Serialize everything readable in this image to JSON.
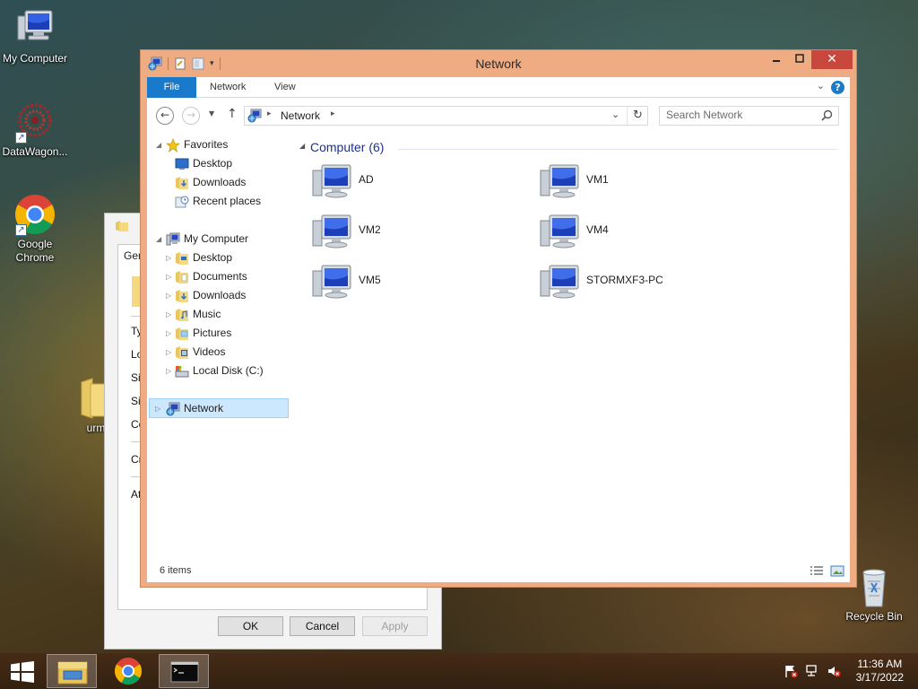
{
  "desktop": {
    "icons": [
      {
        "label": "My Computer"
      },
      {
        "label": "DataWagon..."
      },
      {
        "label": "Google Chrome"
      },
      {
        "label": "Recycle Bin"
      },
      {
        "label": "urm"
      }
    ]
  },
  "background_dialog": {
    "tab_label": "Gen",
    "field_labels": [
      "Ty",
      "Lo",
      "Siz",
      "Siz",
      "Co",
      "Cr",
      "Att"
    ],
    "buttons": {
      "ok": "OK",
      "cancel": "Cancel",
      "apply": "Apply"
    }
  },
  "explorer": {
    "title": "Network",
    "ribbon_tabs": {
      "file": "File",
      "network": "Network",
      "view": "View"
    },
    "help_glyph": "?",
    "address": {
      "location": "Network"
    },
    "search": {
      "placeholder": "Search Network"
    },
    "nav": {
      "favorites": {
        "label": "Favorites",
        "items": [
          "Desktop",
          "Downloads",
          "Recent places"
        ]
      },
      "my_computer": {
        "label": "My Computer",
        "items": [
          "Desktop",
          "Documents",
          "Downloads",
          "Music",
          "Pictures",
          "Videos",
          "Local Disk (C:)"
        ]
      },
      "network": {
        "label": "Network"
      }
    },
    "content": {
      "group_header": "Computer (6)",
      "computers": [
        "AD",
        "VM1",
        "VM2",
        "VM4",
        "VM5",
        "STORMXF3-PC"
      ]
    },
    "status": {
      "item_count": "6 items"
    }
  },
  "taskbar": {
    "clock": {
      "time": "11:36 AM",
      "date": "3/17/2022"
    },
    "active_app": "file-explorer"
  },
  "colors": {
    "window_frame": "#efab82",
    "file_tab": "#1979ca",
    "close_button": "#c9483e",
    "selection": "#cce8ff",
    "group_header": "#1e3287"
  }
}
